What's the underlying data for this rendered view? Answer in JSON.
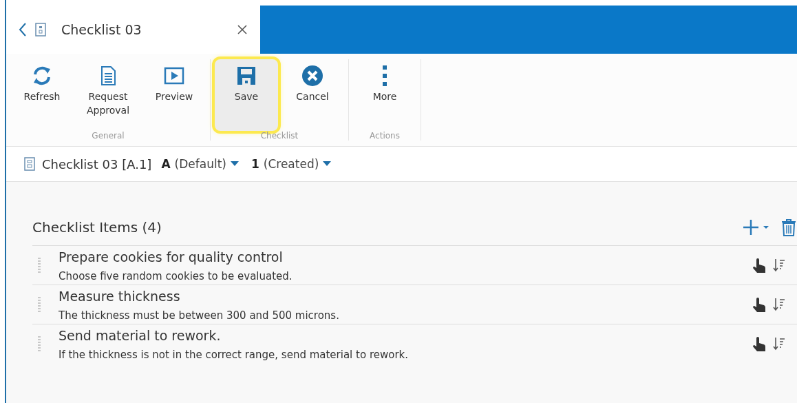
{
  "tab": {
    "title": "Checklist 03"
  },
  "ribbon": {
    "groups": [
      {
        "label": "General",
        "buttons": [
          {
            "kind": "refresh",
            "label": "Refresh",
            "highlighted": false
          },
          {
            "kind": "request",
            "label": "Request Approval",
            "highlighted": false
          },
          {
            "kind": "preview",
            "label": "Preview",
            "highlighted": false
          }
        ]
      },
      {
        "label": "Checklist",
        "buttons": [
          {
            "kind": "save",
            "label": "Save",
            "highlighted": true
          },
          {
            "kind": "cancel",
            "label": "Cancel",
            "highlighted": false
          }
        ]
      },
      {
        "label": "Actions",
        "buttons": [
          {
            "kind": "more",
            "label": "More",
            "highlighted": false
          }
        ]
      }
    ]
  },
  "object_bar": {
    "name": "Checklist 03 [A.1]",
    "revision": "A",
    "revision_state": "(Default)",
    "version": "1",
    "version_state": "(Created)"
  },
  "section": {
    "title": "Checklist Items (4)"
  },
  "items": [
    {
      "title": "Prepare cookies for quality control",
      "description": "Choose five random cookies to be evaluated."
    },
    {
      "title": "Measure thickness",
      "description": "The thickness must be between 300 and 500 microns."
    },
    {
      "title": "Send material to rework.",
      "description": "If the thickness is not in the correct range, send material to rework."
    }
  ]
}
